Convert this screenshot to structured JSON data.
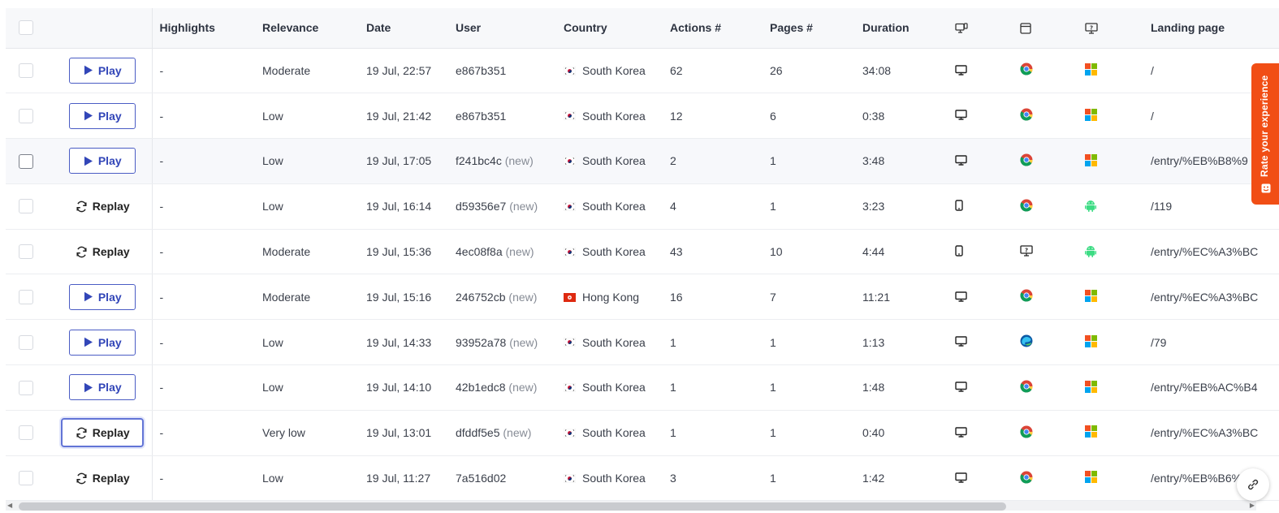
{
  "table": {
    "headers": {
      "highlights": "Highlights",
      "relevance": "Relevance",
      "date": "Date",
      "user": "User",
      "country": "Country",
      "actions": "Actions #",
      "pages": "Pages #",
      "duration": "Duration",
      "device_icon": "device-icon",
      "browser_icon": "browser-icon",
      "os_icon": "os-icon",
      "landing": "Landing page"
    },
    "play_label": "Play",
    "replay_label": "Replay",
    "new_tag": "(new)",
    "rows": [
      {
        "action": "Play",
        "highlights": "-",
        "relevance": "Moderate",
        "date": "19 Jul, 22:57",
        "user": "e867b351",
        "is_new": false,
        "country": "South Korea",
        "flag": "kr",
        "actions": "62",
        "pages": "26",
        "duration": "34:08",
        "device": "desktop",
        "browser": "chrome",
        "os": "windows",
        "landing": "/"
      },
      {
        "action": "Play",
        "highlights": "-",
        "relevance": "Low",
        "date": "19 Jul, 21:42",
        "user": "e867b351",
        "is_new": false,
        "country": "South Korea",
        "flag": "kr",
        "actions": "12",
        "pages": "6",
        "duration": "0:38",
        "device": "desktop",
        "browser": "chrome",
        "os": "windows",
        "landing": "/"
      },
      {
        "action": "Play",
        "highlights": "-",
        "relevance": "Low",
        "date": "19 Jul, 17:05",
        "user": "f241bc4c",
        "is_new": true,
        "country": "South Korea",
        "flag": "kr",
        "actions": "2",
        "pages": "1",
        "duration": "3:48",
        "device": "desktop",
        "browser": "chrome",
        "os": "windows",
        "landing": "/entry/%EB%B8%9",
        "hovered": true
      },
      {
        "action": "Replay",
        "highlights": "-",
        "relevance": "Low",
        "date": "19 Jul, 16:14",
        "user": "d59356e7",
        "is_new": true,
        "country": "South Korea",
        "flag": "kr",
        "actions": "4",
        "pages": "1",
        "duration": "3:23",
        "device": "mobile",
        "browser": "chrome",
        "os": "android",
        "landing": "/119"
      },
      {
        "action": "Replay",
        "highlights": "-",
        "relevance": "Moderate",
        "date": "19 Jul, 15:36",
        "user": "4ec08f8a",
        "is_new": true,
        "country": "South Korea",
        "flag": "kr",
        "actions": "43",
        "pages": "10",
        "duration": "4:44",
        "device": "mobile",
        "browser": "unknown",
        "os": "android",
        "landing": "/entry/%EC%A3%BC"
      },
      {
        "action": "Play",
        "highlights": "-",
        "relevance": "Moderate",
        "date": "19 Jul, 15:16",
        "user": "246752cb",
        "is_new": true,
        "country": "Hong Kong",
        "flag": "hk",
        "actions": "16",
        "pages": "7",
        "duration": "11:21",
        "device": "desktop",
        "browser": "chrome",
        "os": "windows",
        "landing": "/entry/%EC%A3%BC"
      },
      {
        "action": "Play",
        "highlights": "-",
        "relevance": "Low",
        "date": "19 Jul, 14:33",
        "user": "93952a78",
        "is_new": true,
        "country": "South Korea",
        "flag": "kr",
        "actions": "1",
        "pages": "1",
        "duration": "1:13",
        "device": "desktop",
        "browser": "edge",
        "os": "windows",
        "landing": "/79"
      },
      {
        "action": "Play",
        "highlights": "-",
        "relevance": "Low",
        "date": "19 Jul, 14:10",
        "user": "42b1edc8",
        "is_new": true,
        "country": "South Korea",
        "flag": "kr",
        "actions": "1",
        "pages": "1",
        "duration": "1:48",
        "device": "desktop",
        "browser": "chrome",
        "os": "windows",
        "landing": "/entry/%EB%AC%B4"
      },
      {
        "action": "Replay",
        "highlights": "-",
        "relevance": "Very low",
        "date": "19 Jul, 13:01",
        "user": "dfddf5e5",
        "is_new": true,
        "country": "South Korea",
        "flag": "kr",
        "actions": "1",
        "pages": "1",
        "duration": "0:40",
        "device": "desktop",
        "browser": "chrome",
        "os": "windows",
        "landing": "/entry/%EC%A3%BC",
        "focused": true
      },
      {
        "action": "Replay",
        "highlights": "-",
        "relevance": "Low",
        "date": "19 Jul, 11:27",
        "user": "7a516d02",
        "is_new": false,
        "country": "South Korea",
        "flag": "kr",
        "actions": "3",
        "pages": "1",
        "duration": "1:42",
        "device": "desktop",
        "browser": "chrome",
        "os": "windows",
        "landing": "/entry/%EB%B6%"
      }
    ]
  },
  "feedback_tab": {
    "label": "Rate your experience"
  },
  "link_button": {
    "icon": "link-icon"
  }
}
